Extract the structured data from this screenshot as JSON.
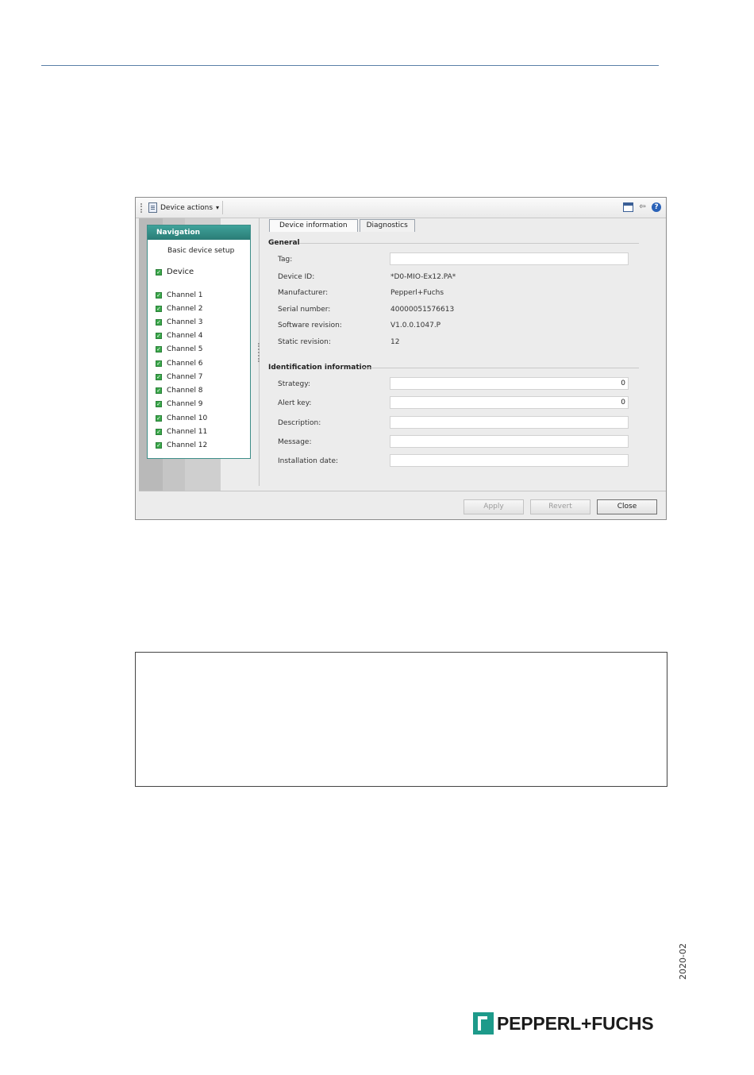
{
  "toolbar": {
    "device_actions_label": "Device actions",
    "dropdown_arrow": "▾"
  },
  "navigation": {
    "title": "Navigation",
    "basic_setup": "Basic device setup",
    "device": "Device",
    "channels": [
      "Channel 1",
      "Channel 2",
      "Channel 3",
      "Channel 4",
      "Channel 5",
      "Channel 6",
      "Channel 7",
      "Channel 8",
      "Channel 9",
      "Channel 10",
      "Channel 11",
      "Channel 12"
    ]
  },
  "tabs": {
    "device_information": "Device information",
    "diagnostics": "Diagnostics"
  },
  "general": {
    "title": "General",
    "tag_label": "Tag:",
    "tag_value": "",
    "device_id_label": "Device ID:",
    "device_id_value": "*D0-MIO-Ex12.PA*",
    "manufacturer_label": "Manufacturer:",
    "manufacturer_value": "Pepperl+Fuchs",
    "serial_label": "Serial number:",
    "serial_value": "40000051576613",
    "software_label": "Software revision:",
    "software_value": "V1.0.0.1047.P",
    "static_label": "Static revision:",
    "static_value": "12"
  },
  "identification": {
    "title": "Identification information",
    "strategy_label": "Strategy:",
    "strategy_value": "0",
    "alert_label": "Alert key:",
    "alert_value": "0",
    "description_label": "Description:",
    "description_value": "",
    "message_label": "Message:",
    "message_value": "",
    "install_label": "Installation date:",
    "install_value": ""
  },
  "buttons": {
    "apply": "Apply",
    "revert": "Revert",
    "close": "Close"
  },
  "page": {
    "date_code": "2020-02",
    "brand": "PEPPERL+FUCHS"
  },
  "colors": {
    "nav_header": "#2a7c76",
    "check_green": "#3aa84a",
    "help_blue": "#2a62b8",
    "rule_blue": "#5a7fa8"
  }
}
